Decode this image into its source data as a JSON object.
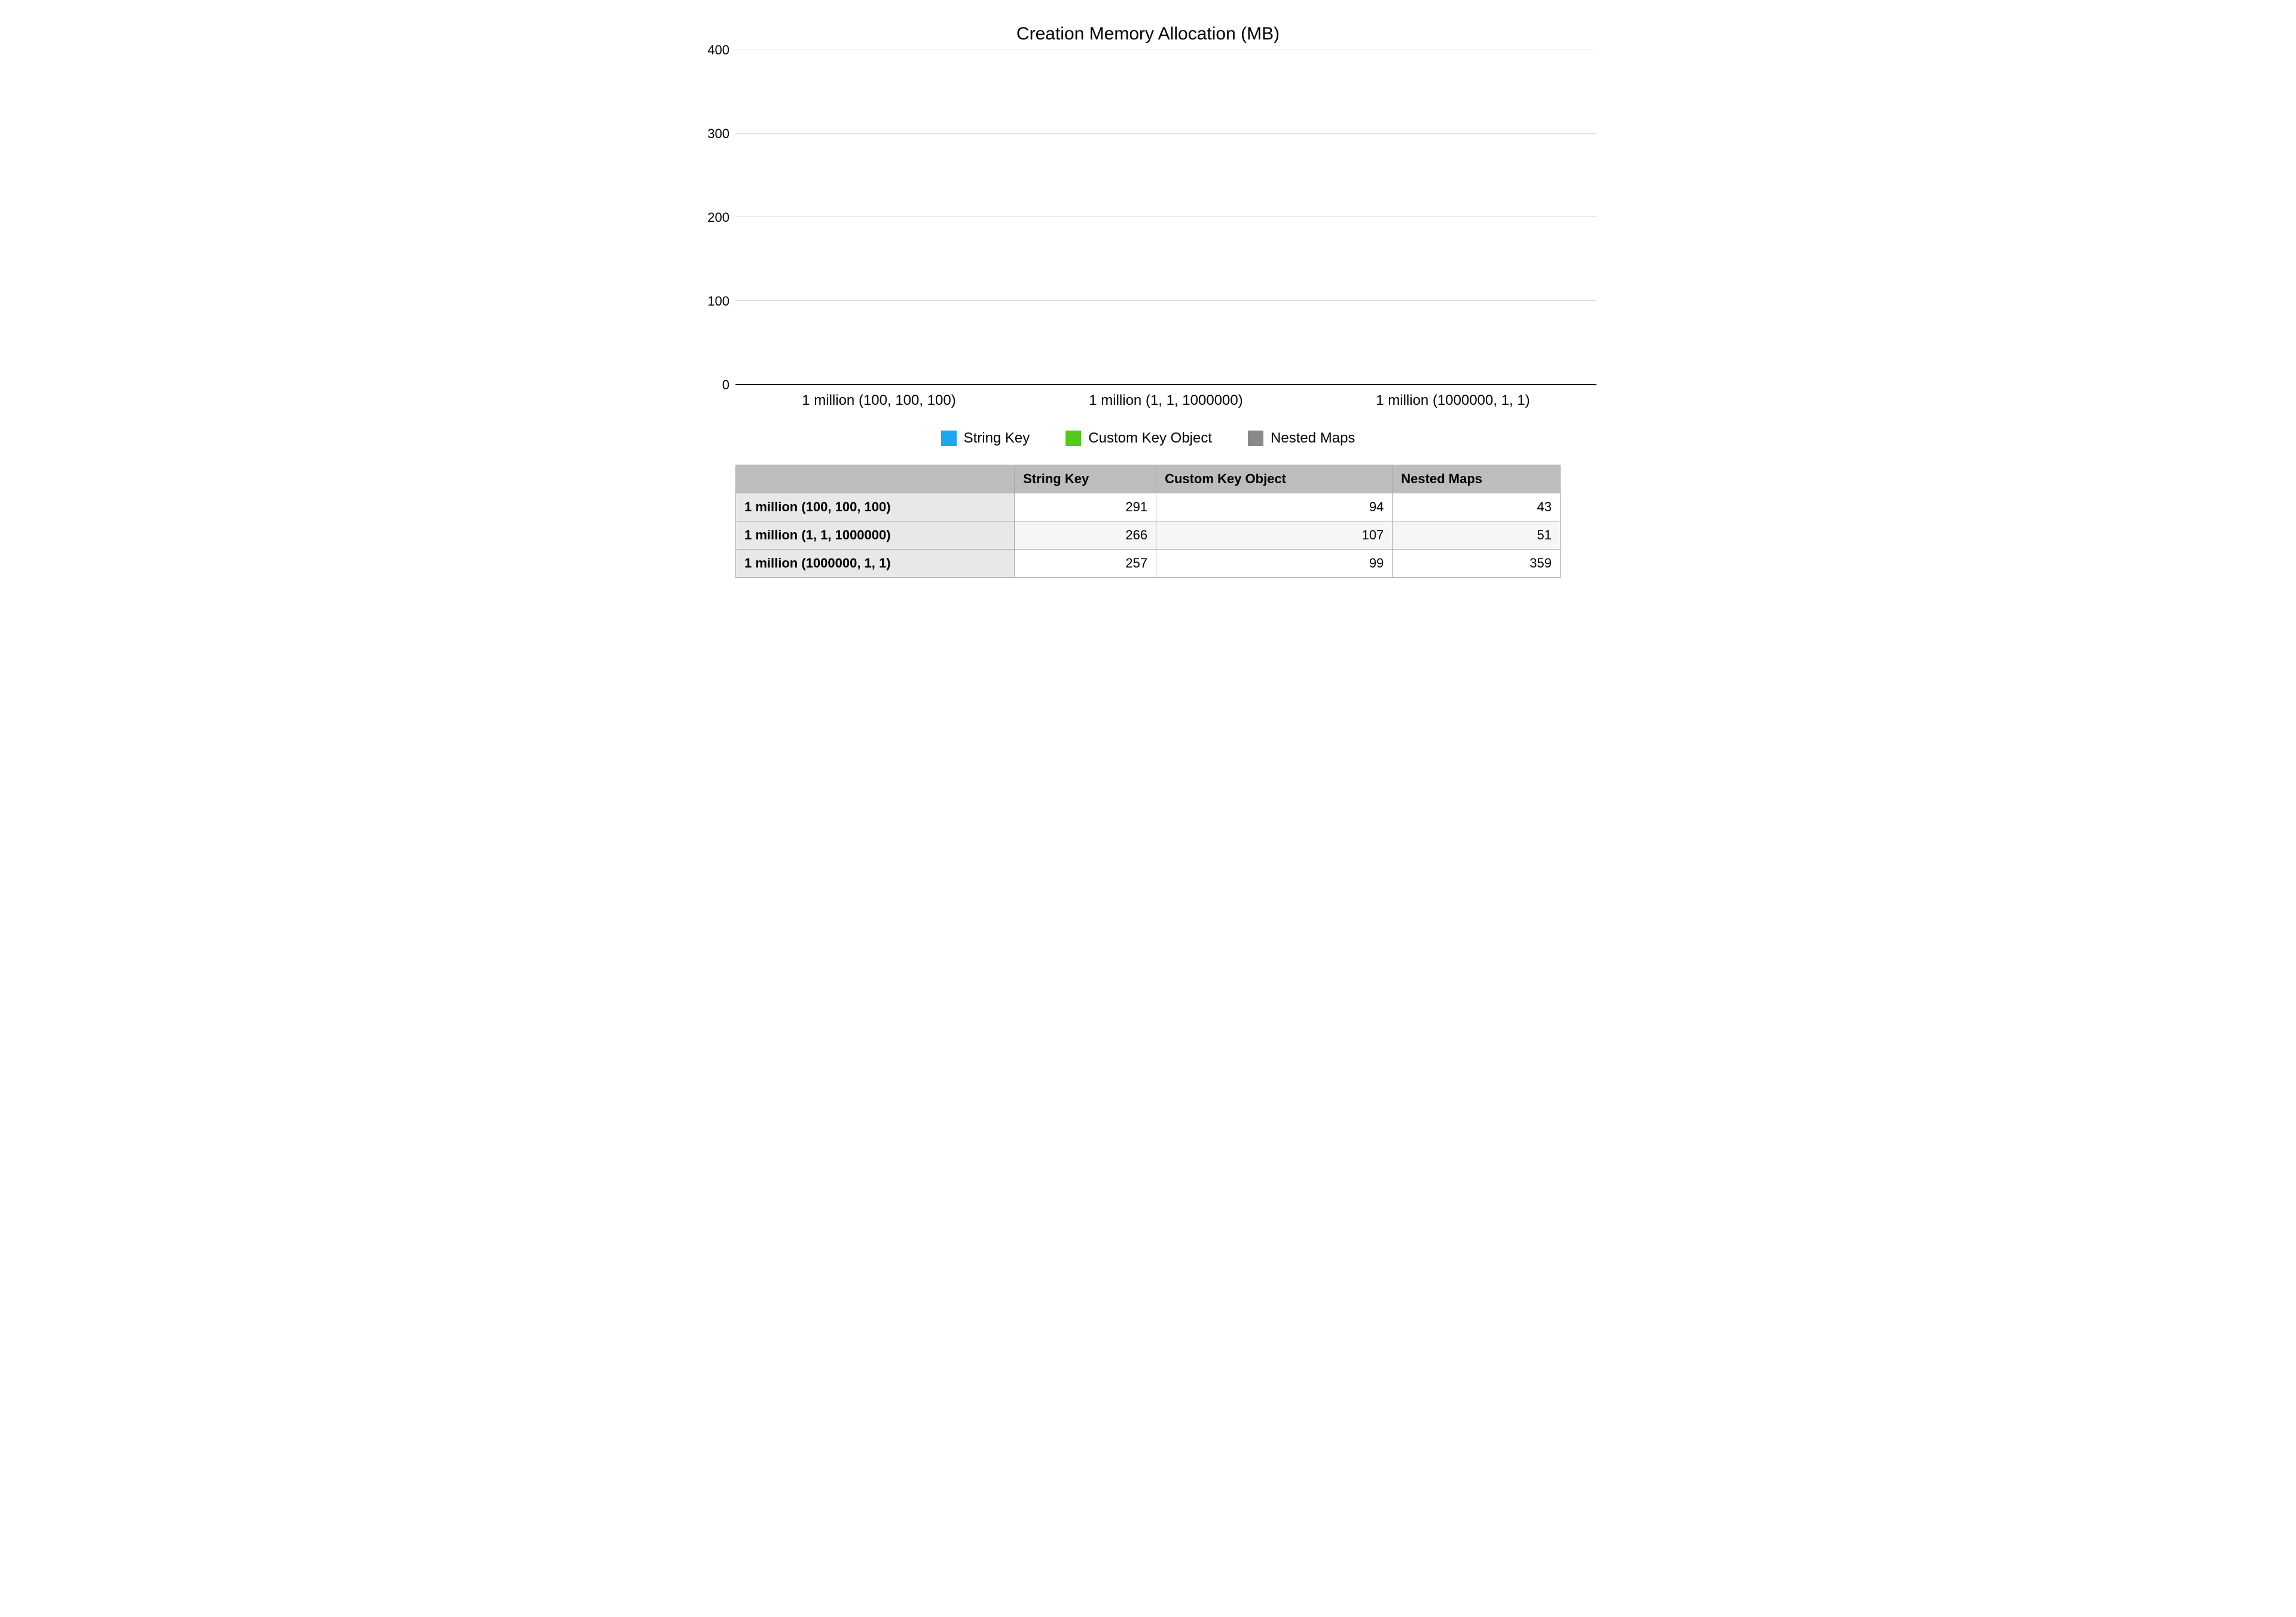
{
  "chart_data": {
    "type": "bar",
    "title": "Creation Memory Allocation (MB)",
    "categories": [
      "1 million (100, 100, 100)",
      "1 million (1, 1, 1000000)",
      "1 million (1000000, 1, 1)"
    ],
    "series": [
      {
        "name": "String Key",
        "color": "#1ea7ed",
        "values": [
          291,
          266,
          257
        ]
      },
      {
        "name": "Custom Key Object",
        "color": "#56c71f",
        "values": [
          94,
          107,
          99
        ]
      },
      {
        "name": "Nested Maps",
        "color": "#898989",
        "values": [
          43,
          51,
          359
        ]
      }
    ],
    "ylim": [
      0,
      400
    ],
    "yticks": [
      0,
      100,
      200,
      300,
      400
    ],
    "xlabel": "",
    "ylabel": ""
  },
  "table": {
    "columns": [
      "String Key",
      "Custom Key Object",
      "Nested Maps"
    ],
    "rows": [
      {
        "label": "1 million (100, 100, 100)",
        "cells": [
          291,
          94,
          43
        ]
      },
      {
        "label": "1 million (1, 1, 1000000)",
        "cells": [
          266,
          107,
          51
        ]
      },
      {
        "label": "1 million (1000000, 1, 1)",
        "cells": [
          257,
          99,
          359
        ]
      }
    ]
  }
}
